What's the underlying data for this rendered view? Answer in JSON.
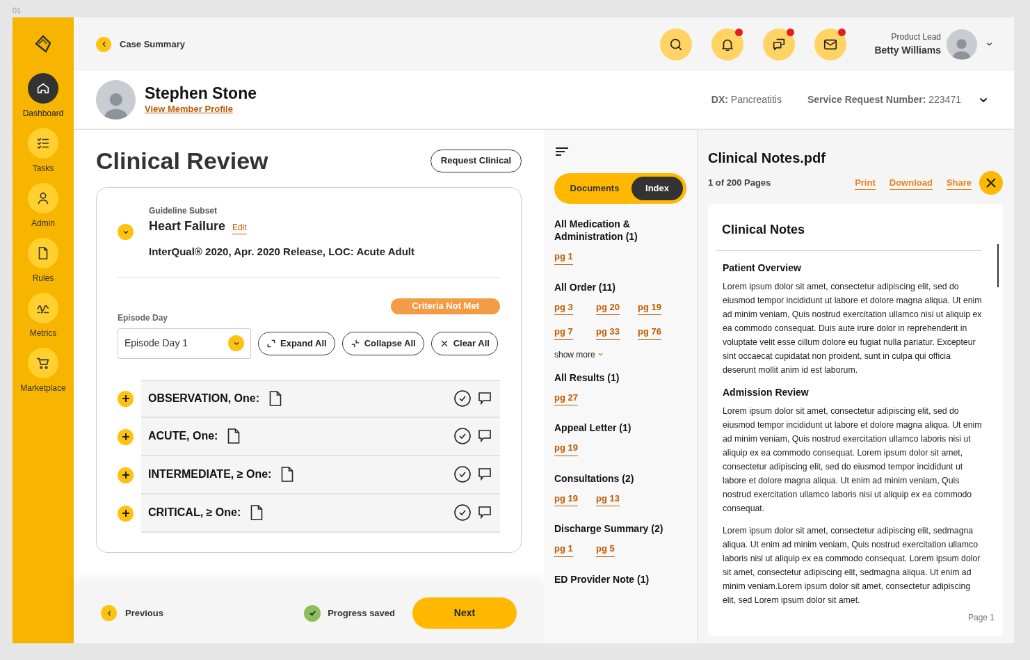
{
  "frame_label": "01",
  "sidebar": {
    "items": [
      {
        "label": "Dashboard",
        "kind": "home",
        "selected": true
      },
      {
        "label": "Tasks",
        "kind": "tasks",
        "selected": false
      },
      {
        "label": "Admin",
        "kind": "user",
        "selected": false
      },
      {
        "label": "Rules",
        "kind": "file",
        "selected": false
      },
      {
        "label": "Metrics",
        "kind": "metrics",
        "selected": false
      },
      {
        "label": "Marketplace",
        "kind": "cart",
        "selected": false
      }
    ]
  },
  "header": {
    "back_label": "Case Summary",
    "actions": [
      {
        "kind": "search",
        "unread": false
      },
      {
        "kind": "bell",
        "unread": true
      },
      {
        "kind": "chat",
        "unread": true
      },
      {
        "kind": "mail",
        "unread": true
      }
    ],
    "user": {
      "role": "Product Lead",
      "name": "Betty Williams"
    }
  },
  "member": {
    "name": "Stephen Stone",
    "profile_link": "View Member Profile",
    "dx_label": "DX:",
    "dx_value": "Pancreatitis",
    "sr_label": "Service Request Number:",
    "sr_value": "223471"
  },
  "review": {
    "title": "Clinical Review",
    "request_button": "Request Clinical",
    "guideline_label": "Guideline Subset",
    "guideline_name": "Heart Failure",
    "edit_link": "Edit",
    "guideline_detail": "InterQual® 2020, Apr. 2020 Release, LOC: Acute Adult",
    "status_badge": "Criteria Not Met",
    "episode_label": "Episode Day",
    "episode_value": "Episode Day 1",
    "tools": [
      {
        "label": "Expand All",
        "kind": "expand"
      },
      {
        "label": "Collapse All",
        "kind": "collapse"
      },
      {
        "label": "Clear All",
        "kind": "clear"
      }
    ],
    "criteria": [
      {
        "label": "OBSERVATION, One:"
      },
      {
        "label": "ACUTE, One:"
      },
      {
        "label": "INTERMEDIATE, ≥ One:"
      },
      {
        "label": "CRITICAL, ≥ One:"
      }
    ]
  },
  "footer": {
    "previous": "Previous",
    "status": "Progress saved",
    "next": "Next"
  },
  "index_panel": {
    "tabs": [
      {
        "label": "Documents",
        "selected": false
      },
      {
        "label": "Index",
        "selected": true
      }
    ],
    "sections": [
      {
        "title": "All Medication & Administration (1)",
        "pages": [
          "pg 1"
        ]
      },
      {
        "title": "All Order (11)",
        "pages": [
          "pg 3",
          "pg 20",
          "pg 19",
          "pg 7",
          "pg 33",
          "pg 76"
        ],
        "more": "show more"
      },
      {
        "title": "All Results (1)",
        "pages": [
          "pg 27"
        ]
      },
      {
        "title": "Appeal Letter (1)",
        "pages": [
          "pg 19"
        ]
      },
      {
        "title": "Consultations (2)",
        "pages": [
          "pg 19",
          "pg 13"
        ]
      },
      {
        "title": "Discharge Summary (2)",
        "pages": [
          "pg 1",
          "pg 5"
        ]
      },
      {
        "title": "ED Provider Note (1)"
      }
    ]
  },
  "document": {
    "file_name": "Clinical Notes.pdf",
    "page_count": "1 of 200 Pages",
    "actions": [
      "Print",
      "Download",
      "Share"
    ],
    "heading": "Clinical Notes",
    "sections": [
      {
        "title": "Patient Overview",
        "paragraphs": [
          "Lorem ipsum dolor sit amet, consectetur adipiscing elit, sed do eiusmod tempor incididunt ut labore et dolore magna aliqua. Ut enim ad minim veniam, Quis nostrud exercitation ullamco  nisi ut aliquip ex ea commodo consequat. Duis aute irure dolor in reprehenderit in voluptate velit esse cillum dolore eu fugiat nulla pariatur. Excepteur sint occaecat cupidatat non proident, sunt in culpa qui officia deserunt mollit anim id est laborum."
        ]
      },
      {
        "title": "Admission Review",
        "paragraphs": [
          "Lorem ipsum dolor sit amet, consectetur adipiscing elit, sed do eiusmod tempor incididunt ut labore et dolore magna aliqua. Ut enim ad minim veniam, Quis nostrud exercitation ullamco laboris nisi ut aliquip ex ea commodo consequat. Lorem ipsum dolor sit amet, consectetur adipiscing elit, sed do eiusmod tempor incididunt ut labore et dolore magna aliqua. Ut enim ad minim veniam, Quis nostrud exercitation ullamco laboris nisi ut aliquip ex ea commodo consequat.",
          "Lorem ipsum dolor sit amet, consectetur adipiscing elit, sedmagna aliqua. Ut enim ad minim veniam, Quis nostrud exercitation ullamco laboris nisi ut aliquip ex ea commodo consequat. Lorem ipsum dolor sit amet, consectetur adipiscing elit, sedmagna aliqua. Ut enim ad minim veniam.Lorem ipsum dolor sit amet, consectetur adipiscing elit, sed Lorem ipsum dolor sit amet."
        ]
      }
    ],
    "page_label": "Page 1"
  }
}
